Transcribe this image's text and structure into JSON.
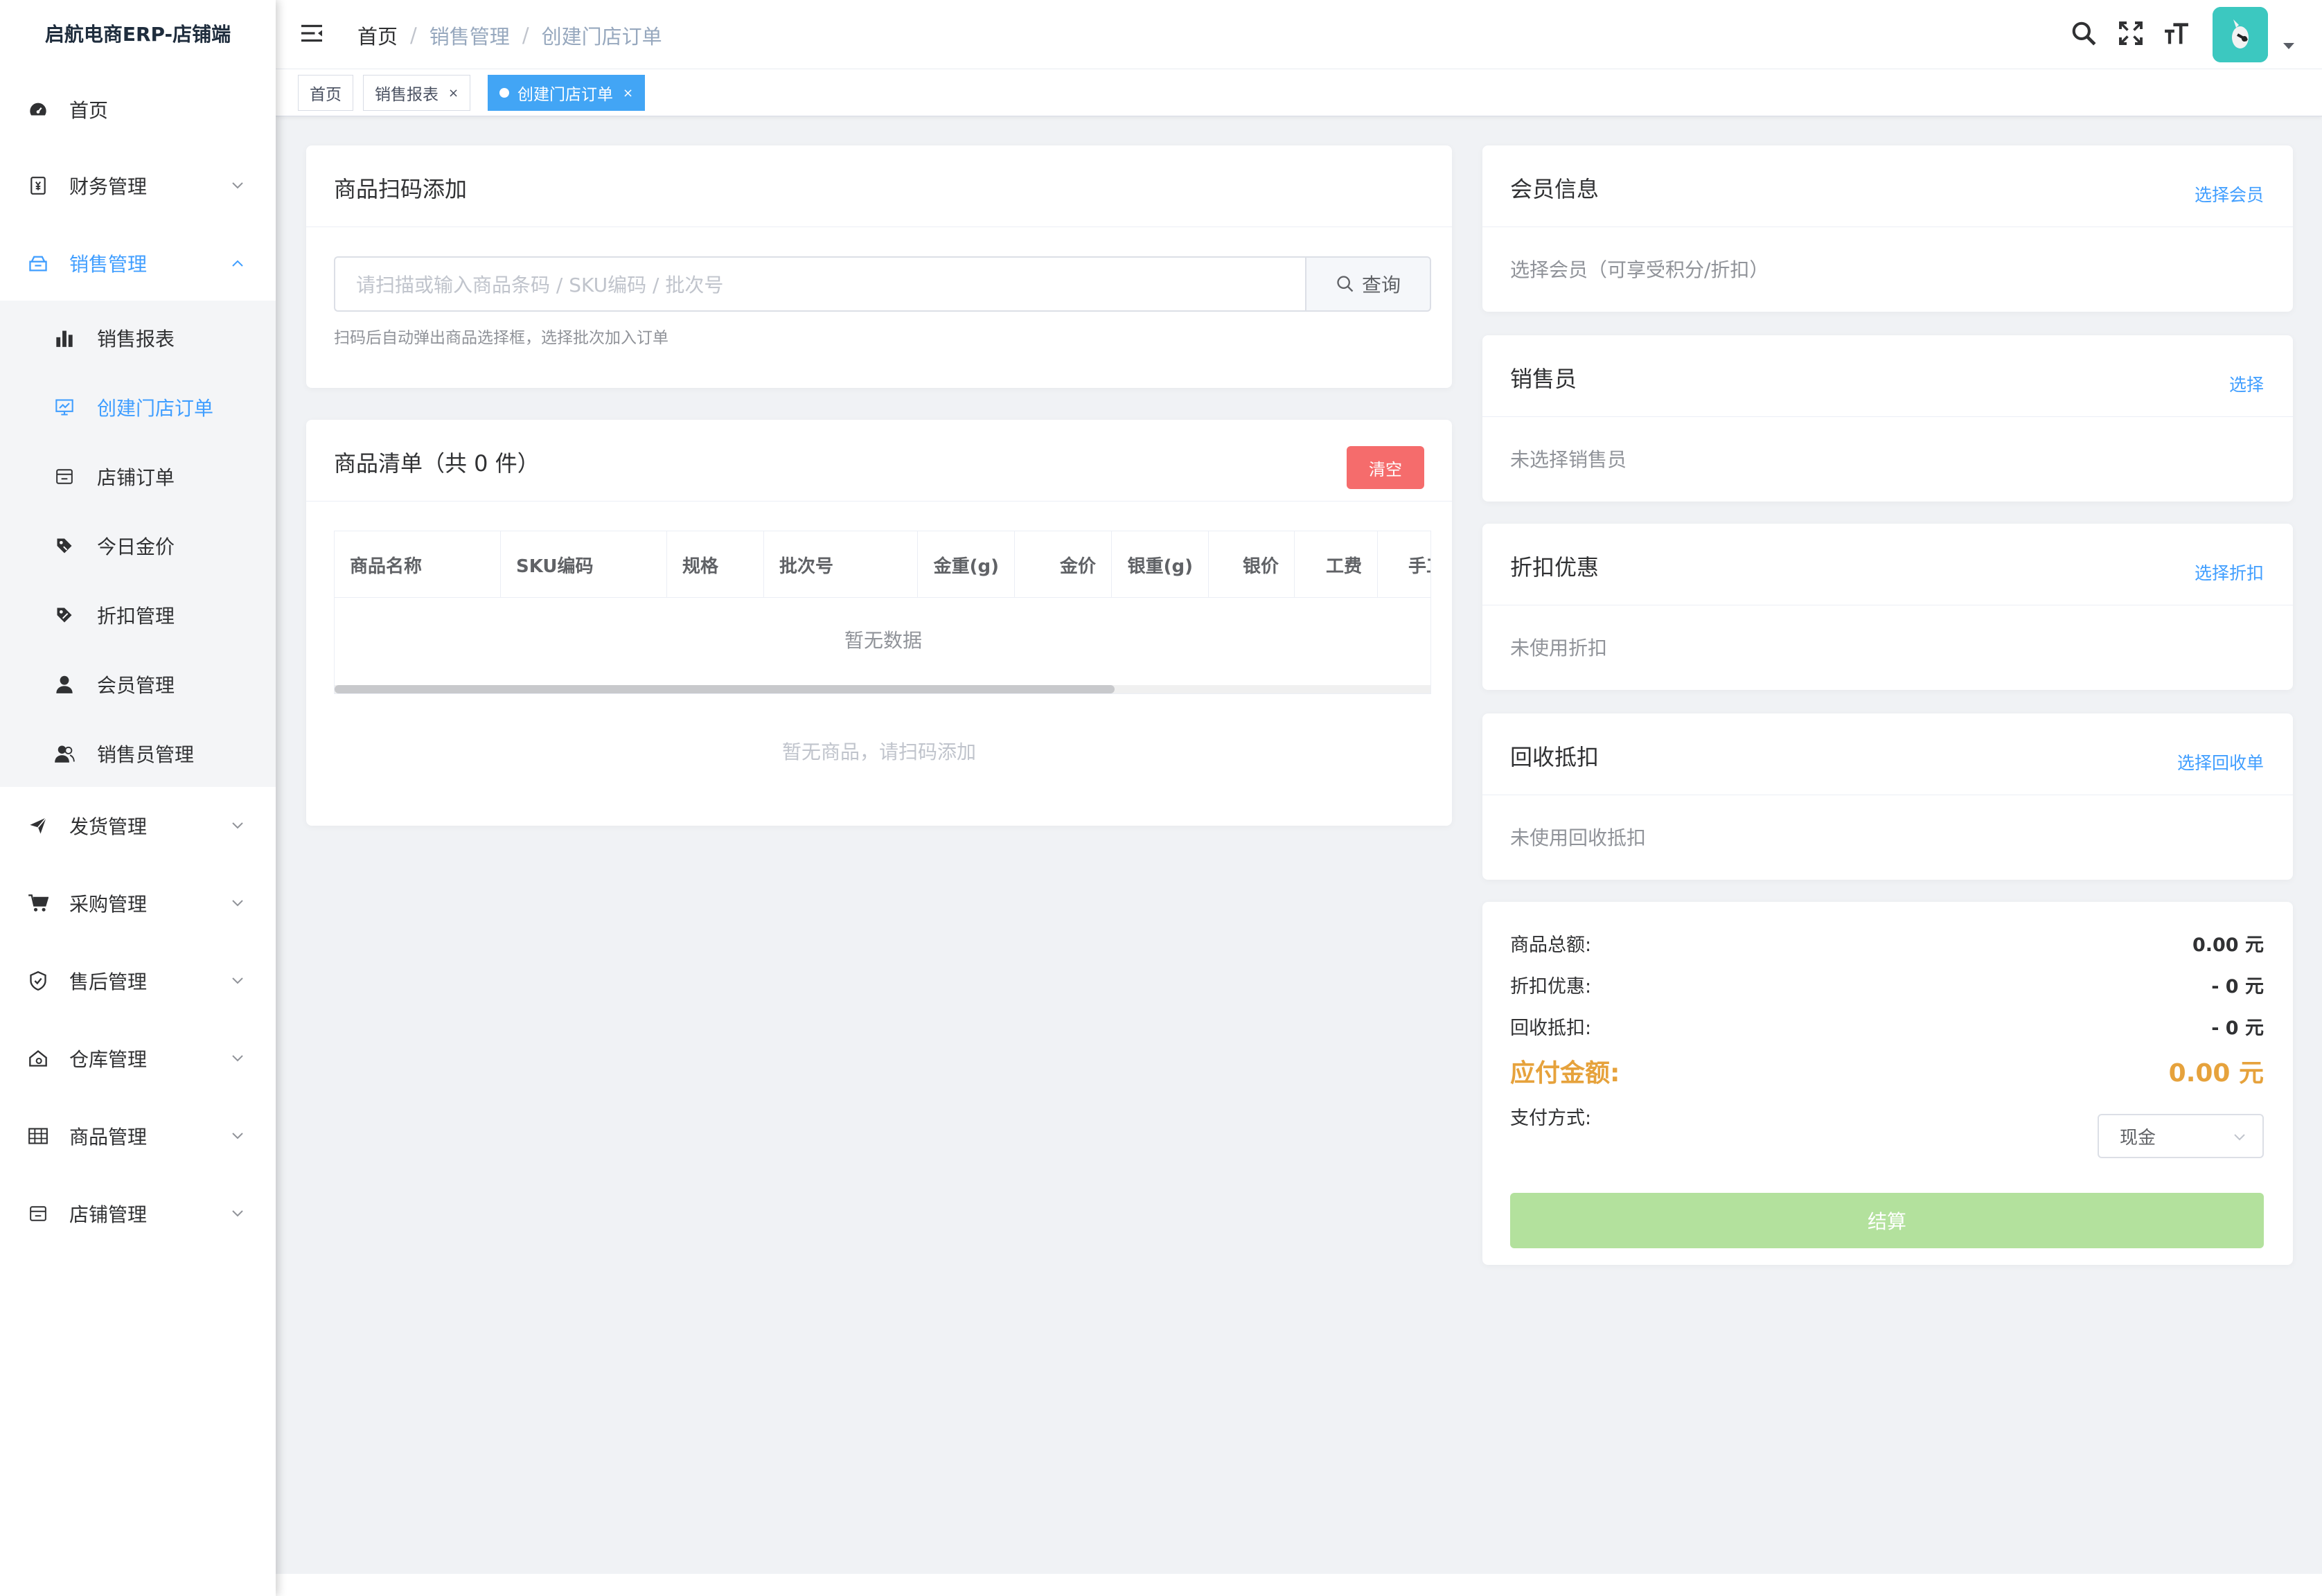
{
  "app": {
    "title": "启航电商ERP-店铺端"
  },
  "sidebar": {
    "items": [
      {
        "label": "首页",
        "icon": "dashboard-icon"
      },
      {
        "label": "财务管理",
        "icon": "finance-icon"
      },
      {
        "label": "销售管理",
        "icon": "sales-icon",
        "expanded": true
      },
      {
        "label": "发货管理",
        "icon": "send-icon"
      },
      {
        "label": "采购管理",
        "icon": "cart-icon"
      },
      {
        "label": "售后管理",
        "icon": "shield-icon"
      },
      {
        "label": "仓库管理",
        "icon": "warehouse-icon"
      },
      {
        "label": "商品管理",
        "icon": "grid-icon"
      },
      {
        "label": "店铺管理",
        "icon": "store-icon"
      }
    ],
    "sales_sub": [
      {
        "label": "销售报表",
        "icon": "bar-chart-icon"
      },
      {
        "label": "创建门店订单",
        "icon": "monitor-icon",
        "active": true
      },
      {
        "label": "店铺订单",
        "icon": "store-icon"
      },
      {
        "label": "今日金价",
        "icon": "price-tag-icon"
      },
      {
        "label": "折扣管理",
        "icon": "discount-icon"
      },
      {
        "label": "会员管理",
        "icon": "user-icon"
      },
      {
        "label": "销售员管理",
        "icon": "users-icon"
      }
    ]
  },
  "header": {
    "breadcrumb": [
      "首页",
      "销售管理",
      "创建门店订单"
    ],
    "separator": "/"
  },
  "tags": [
    {
      "label": "首页"
    },
    {
      "label": "销售报表",
      "close": "×"
    },
    {
      "label": "创建门店订单",
      "close": "×",
      "active": true
    }
  ],
  "scan": {
    "title": "商品扫码添加",
    "placeholder": "请扫描或输入商品条码 / SKU编码 / 批次号",
    "button": "查询",
    "hint": "扫码后自动弹出商品选择框，选择批次加入订单"
  },
  "goods": {
    "title": "商品清单（共 0 件）",
    "clear_button": "清空",
    "columns": [
      "商品名称",
      "SKU编码",
      "规格",
      "批次号",
      "金重(g)",
      "金价",
      "银重(g)",
      "银价",
      "工费",
      "手工"
    ],
    "empty_table": "暂无数据",
    "empty_hint": "暂无商品，请扫码添加"
  },
  "member": {
    "title": "会员信息",
    "link": "选择会员",
    "text": "选择会员（可享受积分/折扣）"
  },
  "salesperson": {
    "title": "销售员",
    "link": "选择",
    "text": "未选择销售员"
  },
  "discount": {
    "title": "折扣优惠",
    "link": "选择折扣",
    "text": "未使用折扣"
  },
  "recycle": {
    "title": "回收抵扣",
    "link": "选择回收单",
    "text": "未使用回收抵扣"
  },
  "summary": {
    "total_label": "商品总额:",
    "total_value": "0.00 元",
    "discount_label": "折扣优惠:",
    "discount_value": "- 0 元",
    "recycle_label": "回收抵扣:",
    "recycle_value": "- 0 元",
    "due_label": "应付金额:",
    "due_value": "0.00 元",
    "pay_label": "支付方式:",
    "pay_value": "现金",
    "settle_button": "结算"
  },
  "colors": {
    "accent": "#409eff",
    "danger": "#f56c6c",
    "warning": "#e6a23c",
    "success_light": "#b3e19d"
  }
}
